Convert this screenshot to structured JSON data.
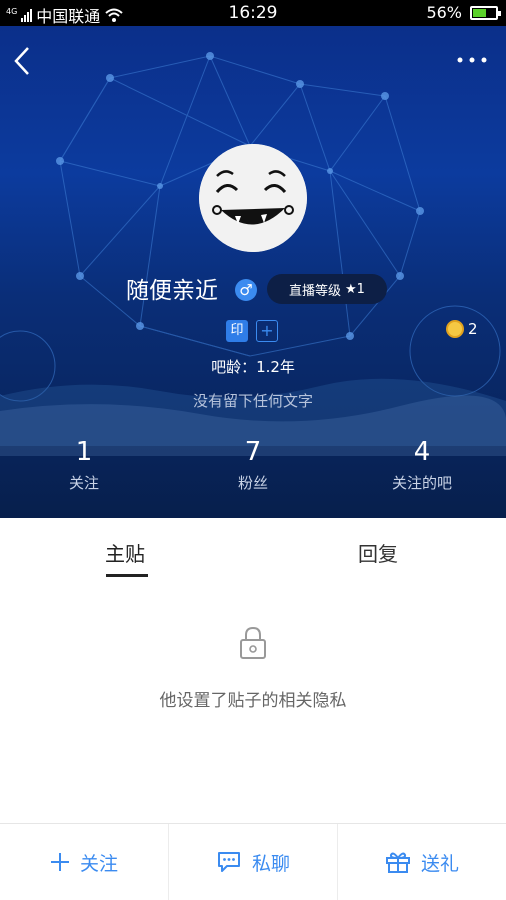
{
  "status_bar": {
    "network_tag": "4G",
    "carrier": "中国联通",
    "time": "16:29",
    "battery": "56%",
    "battery_level": 0.56
  },
  "profile": {
    "username": "随便亲近",
    "gender_symbol": "♂",
    "live_level_label": "直播等级",
    "live_level_value": "★1",
    "tag_yin": "印",
    "tag_add": "+",
    "coin_count": "2",
    "age_text": "吧龄：1.2年",
    "bio": "没有留下任何文字"
  },
  "stats": [
    {
      "num": "1",
      "label": "关注"
    },
    {
      "num": "7",
      "label": "粉丝"
    },
    {
      "num": "4",
      "label": "关注的吧"
    }
  ],
  "tabs": {
    "posts": "主贴",
    "replies": "回复"
  },
  "privacy_text": "他设置了贴子的相关隐私",
  "bottom_bar": {
    "follow": "关注",
    "message": "私聊",
    "gift": "送礼"
  },
  "colors": {
    "accent": "#3b8bf0",
    "header_top": "#0b2f8a",
    "header_bottom": "#071f4c"
  }
}
